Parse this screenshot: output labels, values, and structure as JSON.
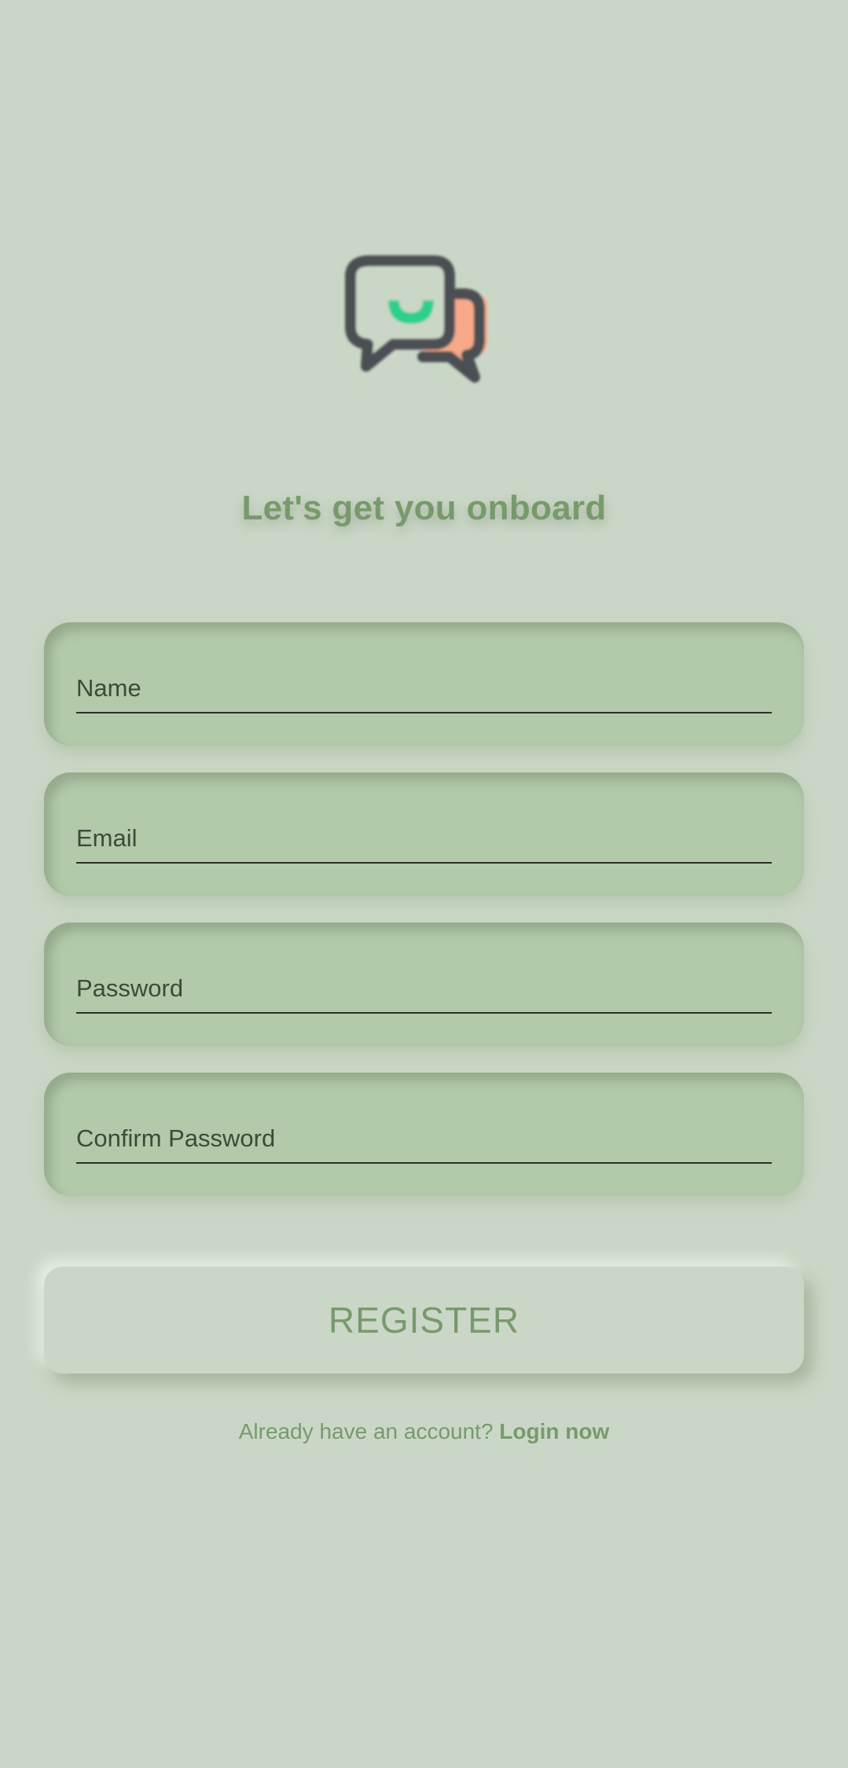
{
  "logo": {
    "icon": "chat-bubbles-icon",
    "colors": {
      "outline": "#4b4f52",
      "smile": "#2fcf8d",
      "accent": "#f7a98a"
    }
  },
  "title": "Let's get you onboard",
  "form": {
    "name_placeholder": "Name",
    "email_placeholder": "Email",
    "password_placeholder": "Password",
    "confirm_password_placeholder": "Confirm Password"
  },
  "register_label": "REGISTER",
  "login_prompt": {
    "text": "Already have an account?",
    "link": "Login now"
  },
  "colors": {
    "background": "#cbd7c6",
    "field_bg": "#b2caaa",
    "accent_text": "#779a6c",
    "field_text": "#3d4a3a"
  }
}
